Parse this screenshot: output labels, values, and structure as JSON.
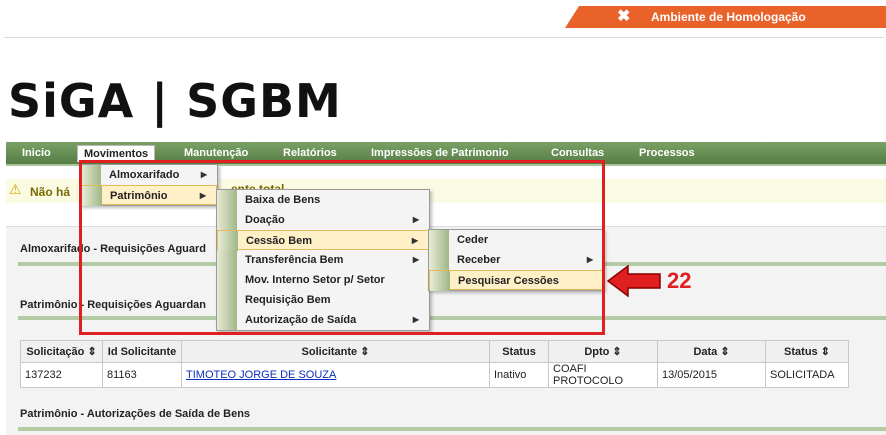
{
  "env": {
    "label": "Ambiente de Homologação",
    "color": "#e8622a"
  },
  "logo": {
    "text": "SiGA | SGBM"
  },
  "nav": {
    "items": [
      "Inicio",
      "Movimentos",
      "Manutenção",
      "Relatórios",
      "Impressões de Patrimonio",
      "Consultas",
      "Processos"
    ],
    "active": "Movimentos"
  },
  "warning": {
    "text_left": "Não há",
    "text_right": "ente total."
  },
  "menus": {
    "movimentos": [
      "Almoxarifado",
      "Patrimônio"
    ],
    "patrimonio": [
      "Baixa de Bens",
      "Doação",
      "Cessão Bem",
      "Transferência Bem",
      "Mov. Interno Setor p/ Setor",
      "Requisição Bem",
      "Autorização de Saída"
    ],
    "cessao": [
      "Ceder",
      "Receber",
      "Pesquisar Cessões"
    ]
  },
  "sections": {
    "almox": "Almoxarifado - Requisições Aguard",
    "patrimonio_req": "Patrimônio - Requisições Aguardan",
    "patrimonio_aut": "Patrimônio - Autorizações de Saída de Bens"
  },
  "table": {
    "headers": [
      "Solicitação ⇕",
      "Id Solicitante",
      "Solicitante ⇕",
      "Status",
      "Dpto ⇕",
      "Data ⇕",
      "Status ⇕"
    ],
    "row": [
      "137232",
      "81163",
      "TIMOTEO JORGE DE SOUZA",
      "Inativo",
      "COAFI PROTOCOLO",
      "13/05/2015",
      "SOLICITADA"
    ]
  },
  "annotation": {
    "number": "22",
    "color": "#e02020"
  }
}
